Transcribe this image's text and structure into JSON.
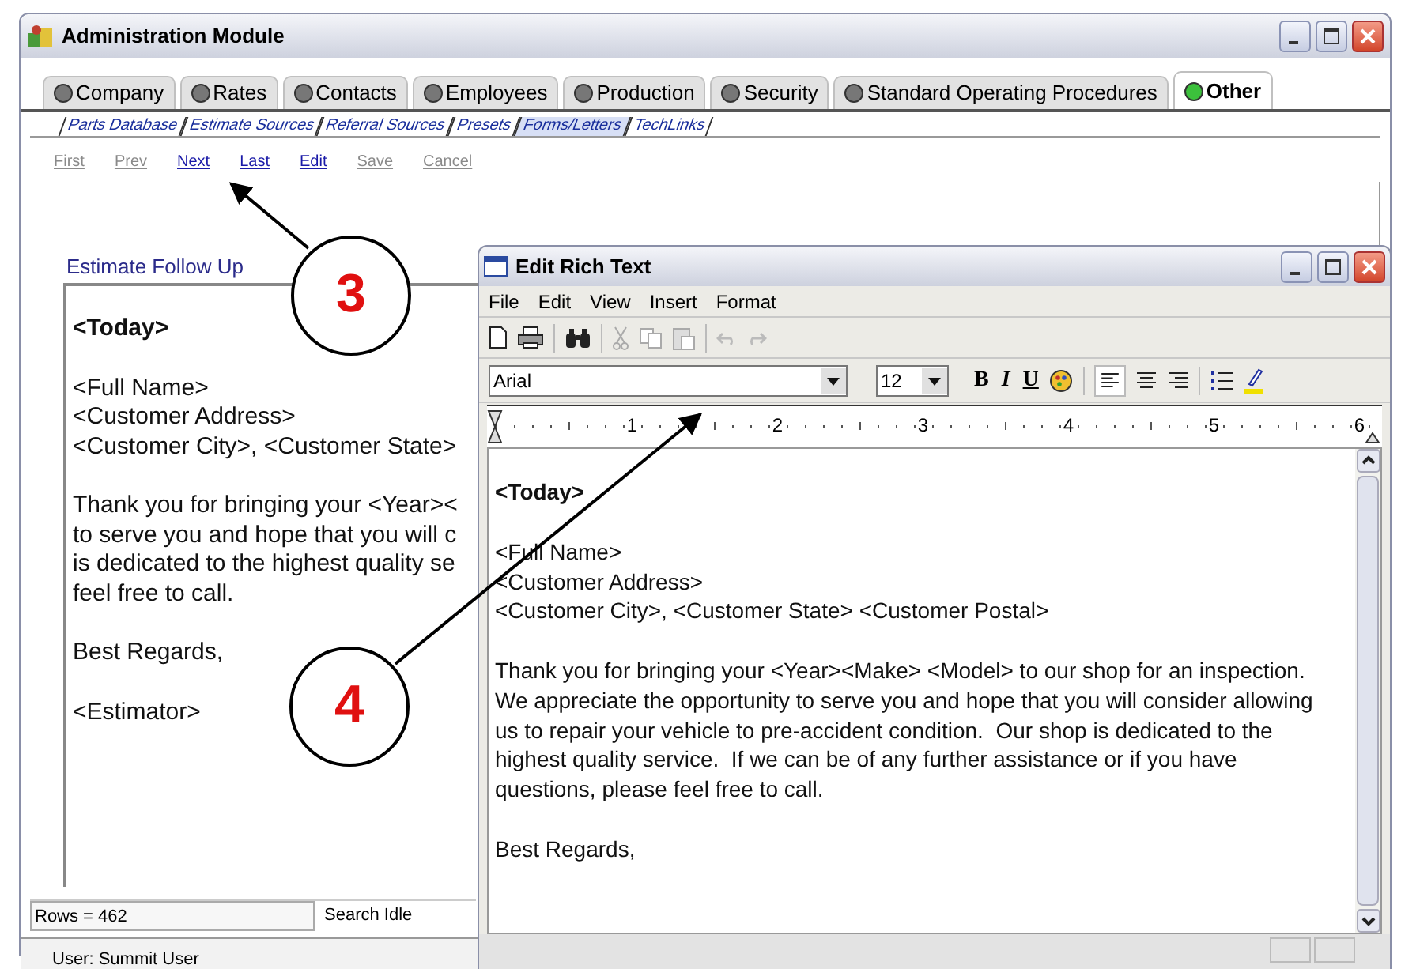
{
  "main_window": {
    "title": "Administration Module",
    "tabs": [
      {
        "label": "Company",
        "selected": false
      },
      {
        "label": "Rates",
        "selected": false
      },
      {
        "label": "Contacts",
        "selected": false
      },
      {
        "label": "Employees",
        "selected": false
      },
      {
        "label": "Production",
        "selected": false
      },
      {
        "label": "Security",
        "selected": false
      },
      {
        "label": "Standard Operating Procedures",
        "selected": false
      },
      {
        "label": "Other",
        "selected": true
      }
    ],
    "subtabs": [
      {
        "label": "Parts Database",
        "selected": false
      },
      {
        "label": "Estimate Sources",
        "selected": false
      },
      {
        "label": "Referral Sources",
        "selected": false
      },
      {
        "label": "Presets",
        "selected": false
      },
      {
        "label": "Forms/Letters",
        "selected": true
      },
      {
        "label": "TechLinks",
        "selected": false
      }
    ],
    "nav": [
      {
        "label": "First",
        "disabled": true
      },
      {
        "label": "Prev",
        "disabled": true
      },
      {
        "label": "Next",
        "disabled": false
      },
      {
        "label": "Last",
        "disabled": false
      },
      {
        "label": "Edit",
        "disabled": false
      },
      {
        "label": "Save",
        "disabled": true
      },
      {
        "label": "Cancel",
        "disabled": true
      }
    ],
    "template_title": "Estimate Follow Up",
    "preview": [
      {
        "bold": true,
        "lines": [
          "<Today>"
        ]
      },
      {
        "bold": false,
        "lines": [
          "<Full Name>",
          "<Customer Address>",
          "<Customer City>, <Customer State>"
        ]
      },
      {
        "bold": false,
        "lines": [
          "Thank you for bringing your <Year><",
          "to serve you and hope that you will c",
          "is dedicated to the highest quality se",
          "feel free to call."
        ]
      },
      {
        "bold": false,
        "lines": [
          "Best Regards,"
        ]
      },
      {
        "bold": false,
        "lines": [
          "<Estimator>"
        ]
      }
    ],
    "rows": "Rows = 462",
    "search": "Search Idle",
    "user": "User: Summit User"
  },
  "editor_window": {
    "title": "Edit Rich Text",
    "menu": [
      "File",
      "Edit",
      "View",
      "Insert",
      "Format"
    ],
    "font": "Arial",
    "size": "12",
    "format_buttons": [
      {
        "label": "B"
      },
      {
        "label": "I"
      },
      {
        "label": "U"
      }
    ],
    "ruler": [
      "1",
      "2",
      "3",
      "4",
      "5",
      "6"
    ],
    "text": [
      {
        "bold": true,
        "lines": [
          "<Today>"
        ]
      },
      {
        "bold": false,
        "lines": [
          "<Full Name>",
          "<Customer Address>",
          "<Customer City>, <Customer State> <Customer Postal>"
        ]
      },
      {
        "bold": false,
        "lines": [
          "Thank you for bringing your <Year><Make> <Model> to our shop for an inspection.",
          "We appreciate the opportunity to serve you and hope that you will consider allowing",
          "us to repair your vehicle to pre-accident condition.  Our shop is dedicated to the",
          "highest quality service.  If we can be of any further assistance or if you have",
          "questions, please feel free to call."
        ]
      },
      {
        "bold": false,
        "lines": [
          "Best Regards,"
        ]
      }
    ]
  },
  "callouts": [
    {
      "number": "3"
    },
    {
      "number": "4"
    }
  ]
}
